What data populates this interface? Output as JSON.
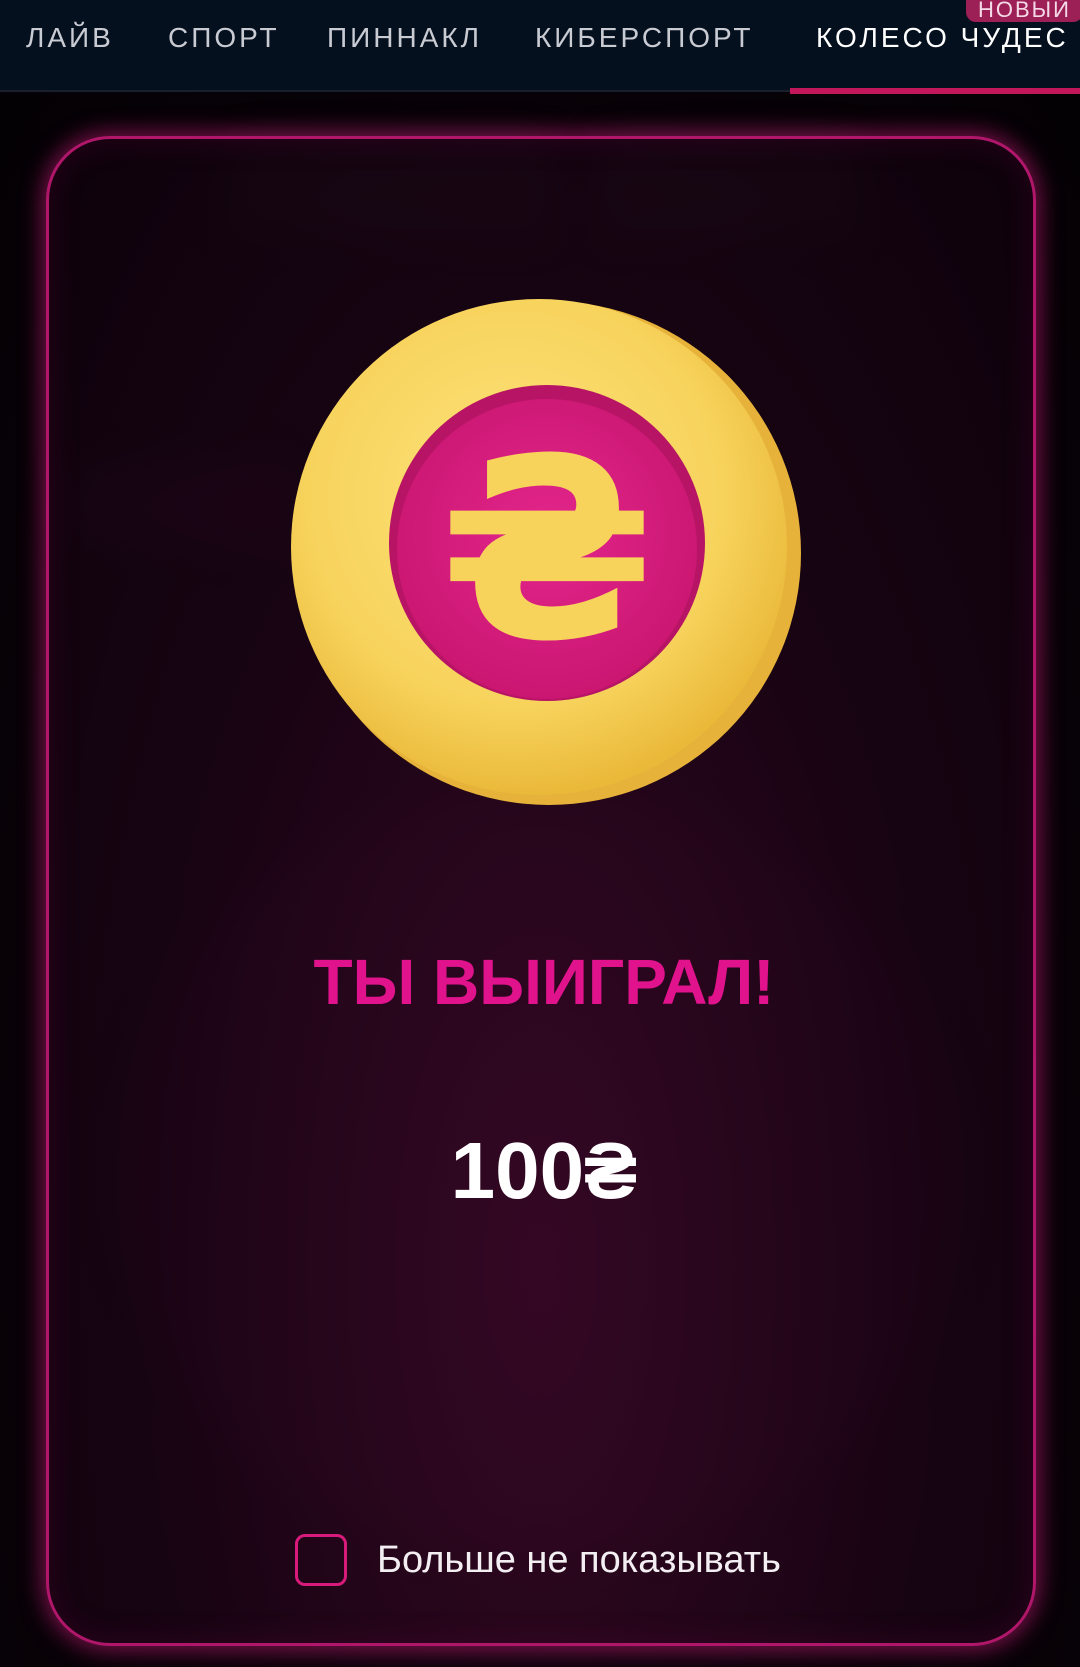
{
  "nav": {
    "tabs": [
      {
        "label": "ЛАЙВ"
      },
      {
        "label": "СПОРТ"
      },
      {
        "label": "ПИННАКЛ"
      },
      {
        "label": "КИБЕРСПОРТ"
      },
      {
        "label": "КОЛЕСО ЧУДЕС",
        "active": true
      }
    ],
    "new_badge": "НОВЫЙ"
  },
  "modal": {
    "coin_icon": "hryvnia-coin-icon",
    "coin_symbol": "₴",
    "title": "ТЫ ВЫИГРАЛ!",
    "prize": "100₴",
    "dont_show_label": "Больше не показывать",
    "dont_show_checked": false
  },
  "colors": {
    "accent": "#e0138d",
    "coin_gold": "#f7d35c",
    "coin_pink": "#d81b7a",
    "nav_bg": "#05101f"
  }
}
